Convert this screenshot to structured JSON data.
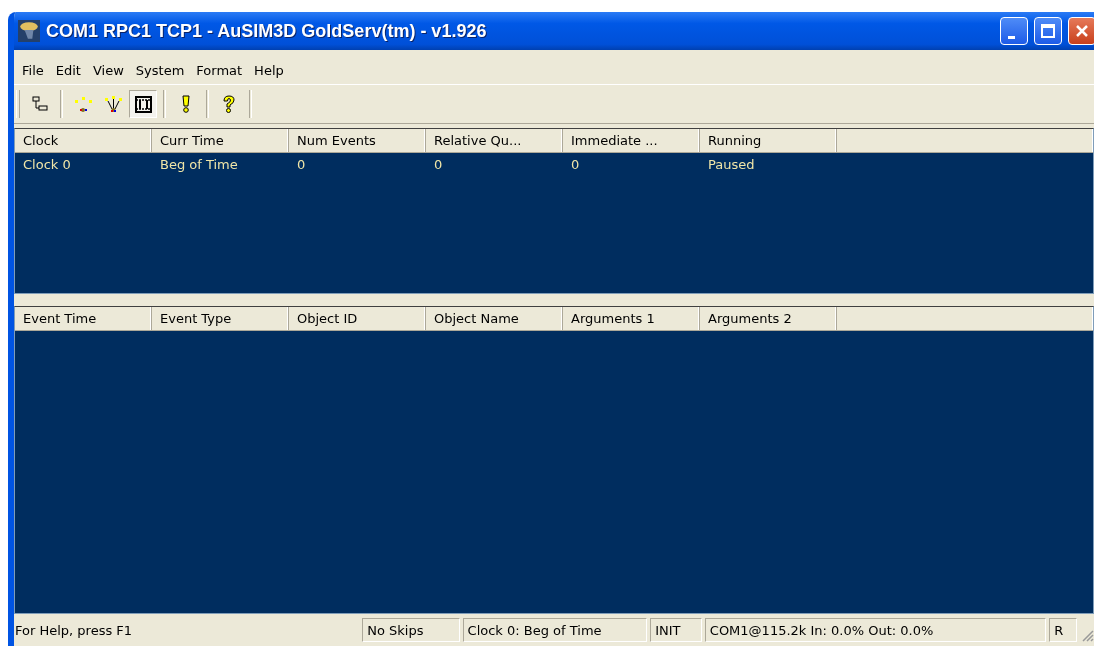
{
  "window": {
    "title": "COM1 RPC1 TCP1 - AuSIM3D GoldServ(tm) - v1.926"
  },
  "menu": [
    "File",
    "Edit",
    "View",
    "System",
    "Format",
    "Help"
  ],
  "toolbar": [
    [
      {
        "kind": "tree",
        "pressed": false
      }
    ],
    [
      {
        "kind": "spread",
        "pressed": false
      },
      {
        "kind": "burst",
        "pressed": false
      },
      {
        "kind": "film",
        "pressed": true
      }
    ],
    [
      {
        "kind": "alert",
        "pressed": false
      }
    ],
    [
      {
        "kind": "help",
        "pressed": false
      }
    ]
  ],
  "clock_table": {
    "columns": [
      "Clock",
      "Curr Time",
      "Num Events",
      "Relative Qu...",
      "Immediate ...",
      "Running"
    ],
    "rows": [
      [
        "Clock 0",
        "Beg of Time",
        "0",
        "0",
        "0",
        "Paused"
      ]
    ]
  },
  "event_table": {
    "columns": [
      "Event Time",
      "Event Type",
      "Object ID",
      "Object Name",
      "Arguments 1",
      "Arguments 2"
    ]
  },
  "status_bar": [
    "For Help, press F1",
    "No Skips",
    "Clock 0: Beg of Time",
    "INIT",
    "COM1@115.2k In: 0.0% Out: 0.0%",
    "R"
  ]
}
